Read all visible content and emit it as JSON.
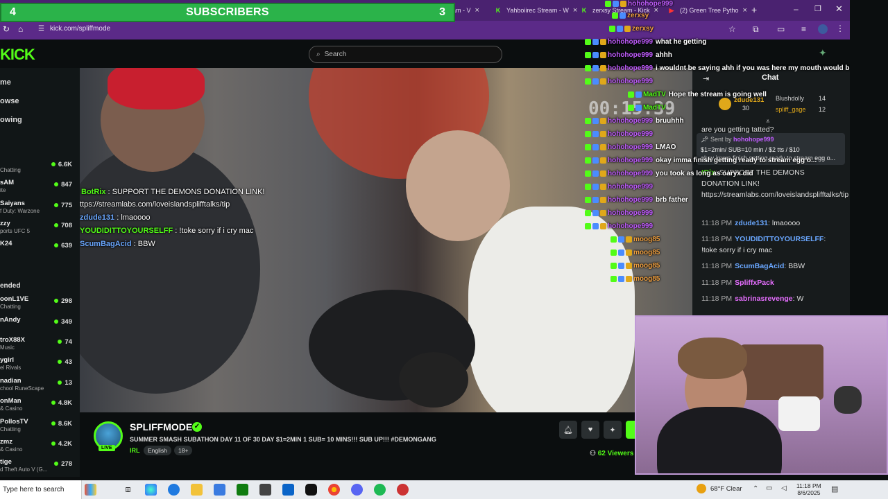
{
  "colors": {
    "kick_green": "#53fc18",
    "browser_purple": "#5b2a88",
    "subs_bar": "#2bb34a"
  },
  "subs_bar": {
    "left": "4",
    "label": "SUBSCRIBERS",
    "right": "3"
  },
  "tabs": [
    {
      "label": "am - V",
      "icon": "kick-icon"
    },
    {
      "label": "Yahboiirec Stream - W",
      "icon": "kick-icon"
    },
    {
      "label": "zerxsy Stream - Kick",
      "icon": "kick-icon"
    },
    {
      "label": "(2) Green Tree Pytho",
      "icon": "youtube-icon"
    }
  ],
  "address": {
    "url": "kick.com/spliffmode"
  },
  "header": {
    "logo": "KICK",
    "search_placeholder": "Search"
  },
  "sidebar": {
    "nav": [
      "me",
      "owse",
      "owing"
    ],
    "following": [
      {
        "name": "",
        "cat": "Chatting",
        "viewers": "6.6K"
      },
      {
        "name": "sAM",
        "cat": "ite",
        "viewers": "847"
      },
      {
        "name": "Saiyans",
        "cat": "f Duty: Warzone",
        "viewers": "775"
      },
      {
        "name": "zzy",
        "cat": "ports UFC 5",
        "viewers": "708"
      },
      {
        "name": "K24",
        "cat": "",
        "viewers": "639"
      }
    ],
    "recommended_label": "ended",
    "recommended": [
      {
        "name": "oonL1VE",
        "cat": "Chatting",
        "viewers": "298"
      },
      {
        "name": "nAndy",
        "cat": "",
        "viewers": "349"
      },
      {
        "name": "troX88X",
        "cat": "Music",
        "viewers": "74"
      },
      {
        "name": "ygirl",
        "cat": "el Rivals",
        "viewers": "43"
      },
      {
        "name": "nadian",
        "cat": "chool RuneScape",
        "viewers": "13"
      },
      {
        "name": "onMan",
        "cat": "& Casino",
        "viewers": "4.8K"
      },
      {
        "name": "PollosTV",
        "cat": "Chatting",
        "viewers": "8.6K"
      },
      {
        "name": "zmz",
        "cat": "& Casino",
        "viewers": "4.2K"
      },
      {
        "name": "tige",
        "cat": "d Theft Auto V (G...",
        "viewers": "278"
      }
    ]
  },
  "video": {
    "timer": "00:15:39",
    "overlay_chat": [
      {
        "user": "BotRix",
        "msg": "SUPPORT THE DEMONS DONATION LINK!"
      },
      {
        "user": "",
        "msg": "ttps://streamlabs.com/loveislandsplifftalks/tip"
      },
      {
        "user": "zdude131",
        "msg": "lmaoooo"
      },
      {
        "user": "YOUDIDITTOYOURSELFF",
        "msg": "!toke sorry if i cry mac"
      },
      {
        "user": "ScumBagAcid",
        "msg": "BBW"
      }
    ]
  },
  "stream": {
    "name": "SPLIFFMODE",
    "live": "LIVE",
    "title": "SUMMER SMASH SUBATHON DAY 11 OF 30 DAY $1=2MIN 1 SUB= 10 MINS!!! SUB UP!!! #DEMONGANG",
    "category": "IRL",
    "tags": [
      "English",
      "18+"
    ],
    "viewers": "62 Viewers"
  },
  "chat": {
    "title": "Chat",
    "leaders": [
      {
        "name": "zdude131",
        "count": "30"
      },
      {
        "name": "Blushdolly",
        "count": "14"
      },
      {
        "name": "spliff_gage",
        "count": "12"
      }
    ],
    "partial_line": "are you getting tatted?",
    "pinned": {
      "sent_by": "Sent by",
      "user": "hohohope999",
      "line1": "$1=2min/ SUB=10 min / $2 tts / $10",
      "line2": "okay imma finish getting ready to stream egg o..."
    },
    "messages": [
      {
        "time": "",
        "user": "tRix",
        "text": "SUPPORT THE DEMONS DONATION LINK! https://streamlabs.com/loveislandsplifftalks/tip"
      },
      {
        "time": "11:18 PM",
        "user": "zdude131",
        "text": "lmaoooo"
      },
      {
        "time": "11:18 PM",
        "user": "YOUDIDITTOYOURSELFF",
        "text": "!toke sorry if i cry mac"
      },
      {
        "time": "11:18 PM",
        "user": "ScumBagAcid",
        "text": "BBW"
      },
      {
        "time": "11:18 PM",
        "user": "SpliffxPack",
        "text": ""
      },
      {
        "time": "11:18 PM",
        "user": "sabrinasrevenge",
        "text": "W"
      }
    ]
  },
  "overlay_chat_column": [
    {
      "user": "hohohope999",
      "msg": ""
    },
    {
      "user": "zerxsy",
      "msg": ""
    },
    {
      "user": "zerxsy",
      "msg": ""
    },
    {
      "user": "hohohope999",
      "msg": "what he getting"
    },
    {
      "user": "hohohope999",
      "msg": "ahhh"
    },
    {
      "user": "hohohope999",
      "msg": "i wouldnt be saying ahh if you was here my mouth would be full"
    },
    {
      "user": "hohohope999",
      "msg": ""
    },
    {
      "user": "MadTV",
      "msg": "Hope the stream is going well"
    },
    {
      "user": "MadTV",
      "msg": ""
    },
    {
      "user": "hohohope999",
      "msg": "bruuhhh"
    },
    {
      "user": "hohohope999",
      "msg": ""
    },
    {
      "user": "hohohope999",
      "msg": "LMAO"
    },
    {
      "user": "hohohope999",
      "msg": "okay imma finish getting ready to stream egg o..."
    },
    {
      "user": "hohohope999",
      "msg": "you took as long as oaryx did"
    },
    {
      "user": "hohohope999",
      "msg": ""
    },
    {
      "user": "hohohope999",
      "msg": "brb father"
    },
    {
      "user": "hohohope999",
      "msg": ""
    },
    {
      "user": "hohohope999",
      "msg": ""
    },
    {
      "user": "moog85",
      "msg": ""
    },
    {
      "user": "moog85",
      "msg": ""
    },
    {
      "user": "moog85",
      "msg": ""
    },
    {
      "user": "moog85",
      "msg": ""
    }
  ],
  "taskbar": {
    "search_placeholder": "Type here to search",
    "weather": "68°F  Clear",
    "time": "11:18 PM",
    "date": "8/6/2025"
  }
}
